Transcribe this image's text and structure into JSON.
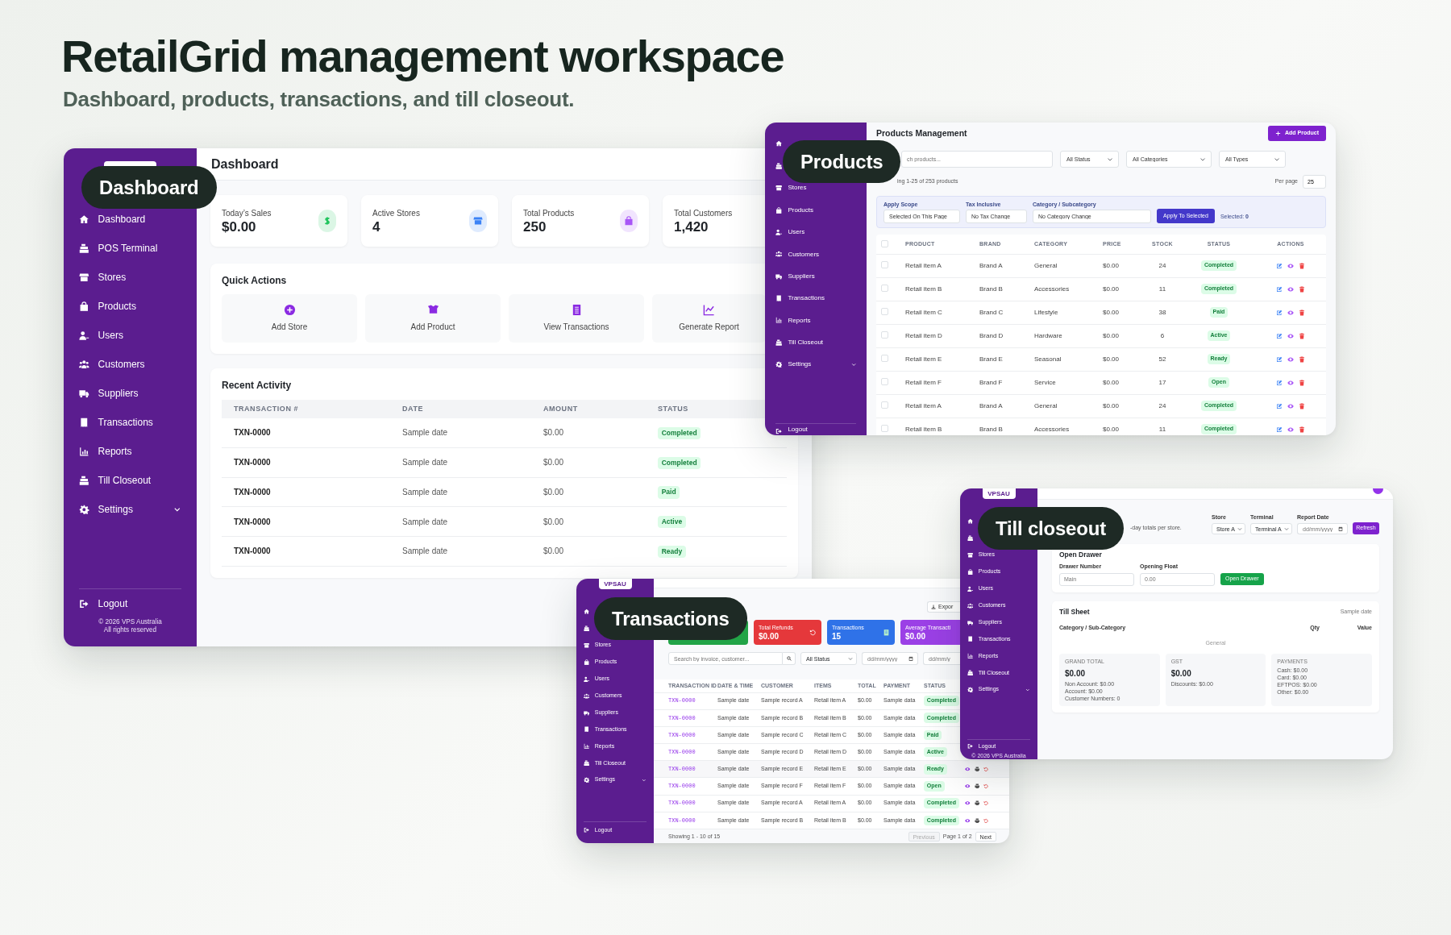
{
  "header": {
    "title": "RetailGrid management workspace",
    "subtitle": "Dashboard, products, transactions, and till closeout."
  },
  "dashboard": {
    "label": "Dashboard",
    "sidebar": {
      "items": [
        {
          "label": "Dashboard",
          "kind": "link"
        },
        {
          "label": "POS Terminal",
          "kind": "link"
        },
        {
          "label": "Stores",
          "kind": "link"
        },
        {
          "label": "Products",
          "kind": "link"
        },
        {
          "label": "Users",
          "kind": "link"
        },
        {
          "label": "Customers",
          "kind": "link"
        },
        {
          "label": "Suppliers",
          "kind": "link"
        },
        {
          "label": "Transactions",
          "kind": "link"
        },
        {
          "label": "Reports",
          "kind": "link"
        },
        {
          "label": "Till Closeout",
          "kind": "link"
        },
        {
          "label": "Settings",
          "kind": "dropdown"
        }
      ],
      "logout": "Logout",
      "footer": [
        "© 2026 VPS Australia",
        "All rights reserved"
      ]
    },
    "page_title": "Dashboard",
    "stats": [
      {
        "label": "Today’s Sales",
        "value": "$0.00",
        "color": "#22c55e"
      },
      {
        "label": "Active Stores",
        "value": "4",
        "color": "#3b82f6"
      },
      {
        "label": "Total Products",
        "value": "250",
        "color": "#a855f7"
      },
      {
        "label": "Total Customers",
        "value": "1,420"
      }
    ],
    "quick_actions": {
      "title": "Quick Actions",
      "items": [
        "Add Store",
        "Add Product",
        "View Transactions",
        "Generate Report"
      ]
    },
    "recent_activity": {
      "title": "Recent Activity",
      "columns": [
        "TRANSACTION #",
        "DATE",
        "AMOUNT",
        "STATUS"
      ],
      "rows": [
        [
          "TXN-0000",
          "Sample date",
          "$0.00",
          "Completed"
        ],
        [
          "TXN-0000",
          "Sample date",
          "$0.00",
          "Completed"
        ],
        [
          "TXN-0000",
          "Sample date",
          "$0.00",
          "Paid"
        ],
        [
          "TXN-0000",
          "Sample date",
          "$0.00",
          "Active"
        ],
        [
          "TXN-0000",
          "Sample date",
          "$0.00",
          "Ready"
        ]
      ]
    }
  },
  "products": {
    "label": "Products",
    "sidebar": {
      "items": [
        {
          "label": "Stores",
          "kind": "link"
        },
        {
          "label": "Products",
          "kind": "link"
        },
        {
          "label": "Users",
          "kind": "link"
        },
        {
          "label": "Customers",
          "kind": "link"
        },
        {
          "label": "Suppliers",
          "kind": "link"
        },
        {
          "label": "Transactions",
          "kind": "link"
        },
        {
          "label": "Reports",
          "kind": "link"
        },
        {
          "label": "Till Closeout",
          "kind": "link"
        },
        {
          "label": "Settings",
          "kind": "dropdown"
        }
      ],
      "logout": "Logout"
    },
    "page_title": "Products Management",
    "add_button": "Add Product",
    "search": {
      "placeholder": "ch products..."
    },
    "filters": [
      "All Status",
      "All Categories",
      "All Types"
    ],
    "summary": "ing 1-25 of 253 products",
    "per_page": {
      "label": "Per page",
      "value": "25"
    },
    "bulk": {
      "fields": [
        {
          "label": "Apply Scope",
          "value": "Selected On This Page"
        },
        {
          "label": "Tax Inclusive",
          "value": "No Tax Change"
        },
        {
          "label": "Category / Subcategory",
          "value": "No Category Change"
        }
      ],
      "button": "Apply To Selected",
      "selected": "Selected: **0**"
    },
    "table": {
      "all_checked": false,
      "columns": [
        "PRODUCT",
        "BRAND",
        "CATEGORY",
        "PRICE",
        "STOCK",
        "STATUS",
        "ACTIONS"
      ],
      "rows": [
        {
          "checked": false,
          "cells": [
            "Retail item A",
            "Brand A",
            "General",
            "$0.00",
            "24",
            "Completed"
          ]
        },
        {
          "checked": false,
          "cells": [
            "Retail item B",
            "Brand B",
            "Accessories",
            "$0.00",
            "11",
            "Completed"
          ]
        },
        {
          "checked": false,
          "cells": [
            "Retail item C",
            "Brand C",
            "Lifestyle",
            "$0.00",
            "38",
            "Paid"
          ]
        },
        {
          "checked": false,
          "cells": [
            "Retail item D",
            "Brand D",
            "Hardware",
            "$0.00",
            "6",
            "Active"
          ]
        },
        {
          "checked": false,
          "cells": [
            "Retail item E",
            "Brand E",
            "Seasonal",
            "$0.00",
            "52",
            "Ready"
          ]
        },
        {
          "checked": false,
          "cells": [
            "Retail item F",
            "Brand F",
            "Service",
            "$0.00",
            "17",
            "Open"
          ]
        },
        {
          "checked": false,
          "cells": [
            "Retail item A",
            "Brand A",
            "General",
            "$0.00",
            "24",
            "Completed"
          ]
        },
        {
          "checked": false,
          "cells": [
            "Retail item B",
            "Brand B",
            "Accessories",
            "$0.00",
            "11",
            "Completed"
          ]
        }
      ]
    }
  },
  "transactions": {
    "label": "Transactions",
    "sidebar": {
      "logo": "VPSAU",
      "items": [
        {
          "label": "Stores",
          "kind": "link"
        },
        {
          "label": "Products",
          "kind": "link"
        },
        {
          "label": "Users",
          "kind": "link"
        },
        {
          "label": "Customers",
          "kind": "link"
        },
        {
          "label": "Suppliers",
          "kind": "link"
        },
        {
          "label": "Transactions",
          "kind": "link"
        },
        {
          "label": "Reports",
          "kind": "link"
        },
        {
          "label": "Till Closeout",
          "kind": "link"
        },
        {
          "label": "Settings",
          "kind": "dropdown"
        }
      ],
      "logout": "Logout"
    },
    "export_button": "Expor",
    "stats": [
      {
        "color": "#22a447"
      },
      {
        "label": "Total Refunds",
        "value": "$0.00",
        "color": "#e5383b"
      },
      {
        "label": "Transactions",
        "value": "15",
        "color": "#2f72e8"
      },
      {
        "label": "Average Transacti",
        "value": "$0.00",
        "color": "#9b40e6"
      }
    ],
    "search": {
      "placeholder": "Search by invoice, customer..."
    },
    "status_filter": "All Status",
    "date_from": {
      "placeholder": "dd/mm/yyyy"
    },
    "date_to": {
      "placeholder": "dd/mm/y"
    },
    "table": {
      "columns": [
        "TRANSACTION ID",
        "DATE & TIME",
        "CUSTOMER",
        "ITEMS",
        "TOTAL",
        "PAYMENT",
        "STATUS"
      ],
      "rows": [
        {
          "cells": [
            "TXN-0000",
            "Sample date",
            "Sample record A",
            "Retail item A",
            "$0.00",
            "Sample data",
            "Completed"
          ]
        },
        {
          "cells": [
            "TXN-0000",
            "Sample date",
            "Sample record B",
            "Retail item B",
            "$0.00",
            "Sample data",
            "Completed"
          ]
        },
        {
          "cells": [
            "TXN-0000",
            "Sample date",
            "Sample record C",
            "Retail item C",
            "$0.00",
            "Sample data",
            "Paid"
          ]
        },
        {
          "cells": [
            "TXN-0000",
            "Sample date",
            "Sample record D",
            "Retail item D",
            "$0.00",
            "Sample data",
            "Active"
          ]
        },
        {
          "cells": [
            "TXN-0000",
            "Sample date",
            "Sample record E",
            "Retail item E",
            "$0.00",
            "Sample data",
            "Ready"
          ]
        },
        {
          "cells": [
            "TXN-0000",
            "Sample date",
            "Sample record F",
            "Retail item F",
            "$0.00",
            "Sample data",
            "Open"
          ]
        },
        {
          "cells": [
            "TXN-0000",
            "Sample date",
            "Sample record A",
            "Retail item A",
            "$0.00",
            "Sample data",
            "Completed"
          ]
        },
        {
          "cells": [
            "TXN-0000",
            "Sample date",
            "Sample record B",
            "Retail item B",
            "$0.00",
            "Sample data",
            "Completed"
          ]
        }
      ]
    },
    "footer": {
      "summary": "Showing 1 - 10 of 15",
      "page": "Page 1 of 2",
      "buttons": [
        {
          "label": "Previous",
          "disabled": true
        },
        {
          "label": "Next",
          "disabled": false
        }
      ]
    }
  },
  "till": {
    "label": "Till closeout",
    "sidebar": {
      "logo": "VPSAU",
      "items": [
        {
          "label": "Stores",
          "kind": "link"
        },
        {
          "label": "Products",
          "kind": "link"
        },
        {
          "label": "Users",
          "kind": "link"
        },
        {
          "label": "Customers",
          "kind": "link"
        },
        {
          "label": "Suppliers",
          "kind": "link"
        },
        {
          "label": "Transactions",
          "kind": "link"
        },
        {
          "label": "Reports",
          "kind": "link"
        },
        {
          "label": "Till Closeout",
          "kind": "link"
        },
        {
          "label": "Settings",
          "kind": "dropdown"
        }
      ],
      "logout": "Logout",
      "footer": [
        "© 2026 VPS Australia"
      ]
    },
    "subtitle": "-day totals per store.",
    "controls": [
      {
        "kind": "select",
        "label": "Store",
        "value": "Store A"
      },
      {
        "kind": "select",
        "label": "Terminal",
        "value": "Terminal A"
      },
      {
        "kind": "date",
        "label": "Report Date",
        "placeholder": "dd/mm/yyyy"
      }
    ],
    "refresh_button": "Refresh",
    "open_drawer": {
      "title": "Open Drawer",
      "fields": [
        {
          "label": "Drawer Number",
          "placeholder": "Main"
        },
        {
          "label": "Opening Float",
          "placeholder": "0.00"
        }
      ],
      "button": "Open Drawer"
    },
    "till_sheet": {
      "title": "Till Sheet",
      "date": "Sample date",
      "columns": [
        "Category / Sub-Category",
        "Qty",
        "Value"
      ],
      "rows": [
        "General"
      ],
      "summaries": [
        {
          "title": "GRAND TOTAL",
          "value": "$0.00",
          "lines": [
            "Non Account: $0.00",
            "Account: $0.00",
            "Customer Numbers: 0"
          ]
        },
        {
          "title": "GST",
          "value": "$0.00",
          "lines": [
            "Discounts: $0.00"
          ]
        },
        {
          "title": "PAYMENTS",
          "lines": [
            "Cash: $0.00",
            "Card: $0.00",
            "EFTPOS: $0.00",
            "Other: $0.00"
          ]
        }
      ]
    }
  }
}
